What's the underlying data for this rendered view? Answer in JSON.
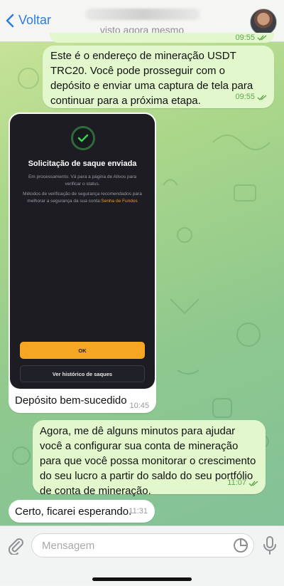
{
  "header": {
    "back_label": "Voltar",
    "status": "visto agora mesmo"
  },
  "messages": {
    "prev_time": "09:55",
    "m1": {
      "text": "Este é o endereço de mineração USDT TRC20. Você pode prosseguir com o depósito e enviar uma captura de tela para continuar para a próxima etapa.",
      "time": "09:55"
    },
    "m2": {
      "screenshot": {
        "title": "Solicitação de saque enviada",
        "line1": "Em processamento. Vá para a página de Ativos para verificar o status.",
        "line2": "Métodos de verificação de segurança recomendados para melhorar a segurança da sua conta:",
        "link": "Senha de Fundos",
        "ok_label": "OK",
        "history_label": "Ver histórico de saques"
      },
      "caption": "Depósito bem-sucedido",
      "time": "10:45"
    },
    "m3": {
      "text": "Agora, me dê alguns minutos para ajudar você a configurar sua conta de mineração para que você possa monitorar o crescimento do seu lucro a partir do saldo do seu portfólio de conta de mineração.",
      "time": "11:07"
    },
    "m4": {
      "text": "Certo, ficarei esperando.",
      "time": "11:31"
    }
  },
  "composer": {
    "placeholder": "Mensagem"
  },
  "colors": {
    "accent": "#2f7de1",
    "outgoing_bubble": "#e2f7cb",
    "incoming_bubble": "#ffffff",
    "ok_button": "#f5a623"
  }
}
